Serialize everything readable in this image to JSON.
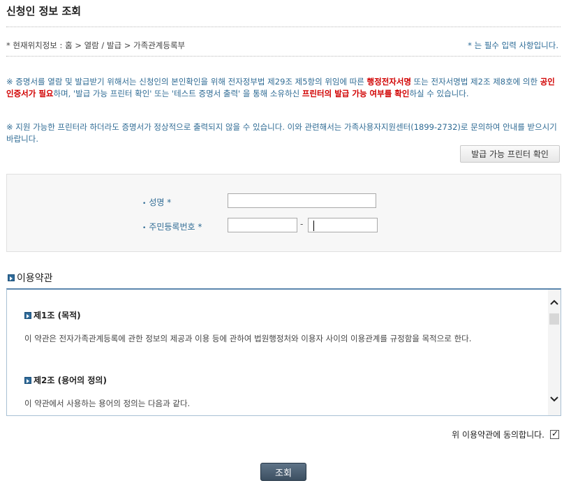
{
  "page": {
    "title": "신청인 정보 조회",
    "location": "* 현재위치정보 : 홈 > 열람 / 발급 > 가족관계등록부",
    "required_note": "* 는 필수 입력 사항입니다."
  },
  "notice1": {
    "a": "※ 증명서를 열람 및 발급받기 위해서는 신청인의 본인확인을 위해 전자정부법 제29조 제5항의 위임에 따른 ",
    "b": "행정전자서명",
    "c": " 또는 전자서명법 제2조 제8호에 의한 ",
    "d": "공인인증서가 필요",
    "e": "하며, '발급 가능 프린터 확인' 또는 '테스트 증명서 출력' 을 통해 소유하신 ",
    "f": "프린터의 발급 가능 여부를 확인",
    "g": "하실 수 있습니다."
  },
  "notice2": "※ 지원 가능한 프린터라 하더라도 증명서가 정상적으로 출력되지 않을 수 있습니다. 이와 관련해서는 가족사용자지원센터(1899-2732)로 문의하여 안내를 받으시기 바랍니다.",
  "printer_button": "발급 가능 프린터 확인",
  "form": {
    "bullet": "•",
    "name_label": "성명 *",
    "name_value": "",
    "rrn_label": "주민등록번호 *",
    "rrn_front_value": "",
    "rrn_separator": "-",
    "rrn_back_value": ""
  },
  "terms": {
    "heading": "이용약관",
    "articles": [
      {
        "title": "제1조 (목적)",
        "text": "이 약관은 전자가족관계등록에 관한 정보의 제공과 이용 등에 관하여 법원행정처와 이용자 사이의 이용관계를 규정함을 목적으로 한다."
      },
      {
        "title": "제2조 (용어의 정의)",
        "text": "이 약관에서 사용하는 용어의 정의는 다음과 같다."
      }
    ],
    "scroll_up": "⌃",
    "scroll_down": "⌄"
  },
  "agree": {
    "label": "위 이용약관에 동의합니다.",
    "checked": true
  },
  "submit_button": "조회",
  "colors": {
    "accent_blue": "#2f6b94",
    "highlight_red": "#d10000",
    "submit_bg": "#3c4f61"
  }
}
